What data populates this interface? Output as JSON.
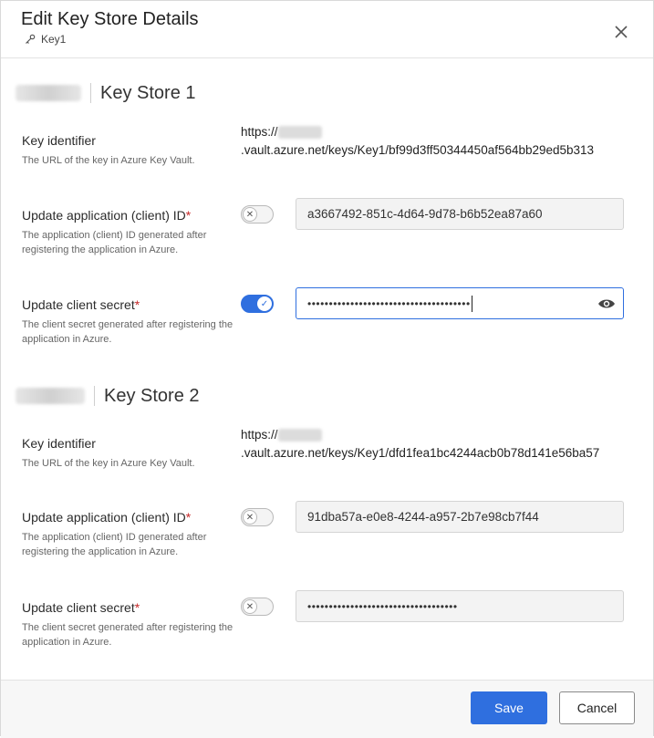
{
  "header": {
    "title": "Edit Key Store Details",
    "subtitle": "Key1"
  },
  "stores": [
    {
      "name": "Key Store 1",
      "key_identifier_label": "Key identifier",
      "key_identifier_help": "The URL of the key in Azure Key Vault.",
      "key_url_prefix": "https://",
      "key_url_rest": ".vault.azure.net/keys/Key1/bf99d3ff50344450af564bb29ed5b313",
      "app_id_label": "Update application (client) ID",
      "app_id_help": "The application (client) ID generated after registering the application in Azure.",
      "app_id_toggle": false,
      "app_id_value": "a3667492-851c-4d64-9d78-b6b52ea87a60",
      "secret_label": "Update client secret",
      "secret_help": "The client secret generated after registering the application in Azure.",
      "secret_toggle": true,
      "secret_value": "••••••••••••••••••••••••••••••••••••••"
    },
    {
      "name": "Key Store 2",
      "key_identifier_label": "Key identifier",
      "key_identifier_help": "The URL of the key in Azure Key Vault.",
      "key_url_prefix": "https://",
      "key_url_rest": ".vault.azure.net/keys/Key1/dfd1fea1bc4244acb0b78d141e56ba57",
      "app_id_label": "Update application (client) ID",
      "app_id_help": "The application (client) ID generated after registering the application in Azure.",
      "app_id_toggle": false,
      "app_id_value": "91dba57a-e0e8-4244-a957-2b7e98cb7f44",
      "secret_label": "Update client secret",
      "secret_help": "The client secret generated after registering the application in Azure.",
      "secret_toggle": false,
      "secret_value": "•••••••••••••••••••••••••••••••••••"
    }
  ],
  "required_marker": "*",
  "footer": {
    "save_label": "Save",
    "cancel_label": "Cancel"
  },
  "colors": {
    "accent": "#2f6fdf",
    "required": "#c62828"
  }
}
